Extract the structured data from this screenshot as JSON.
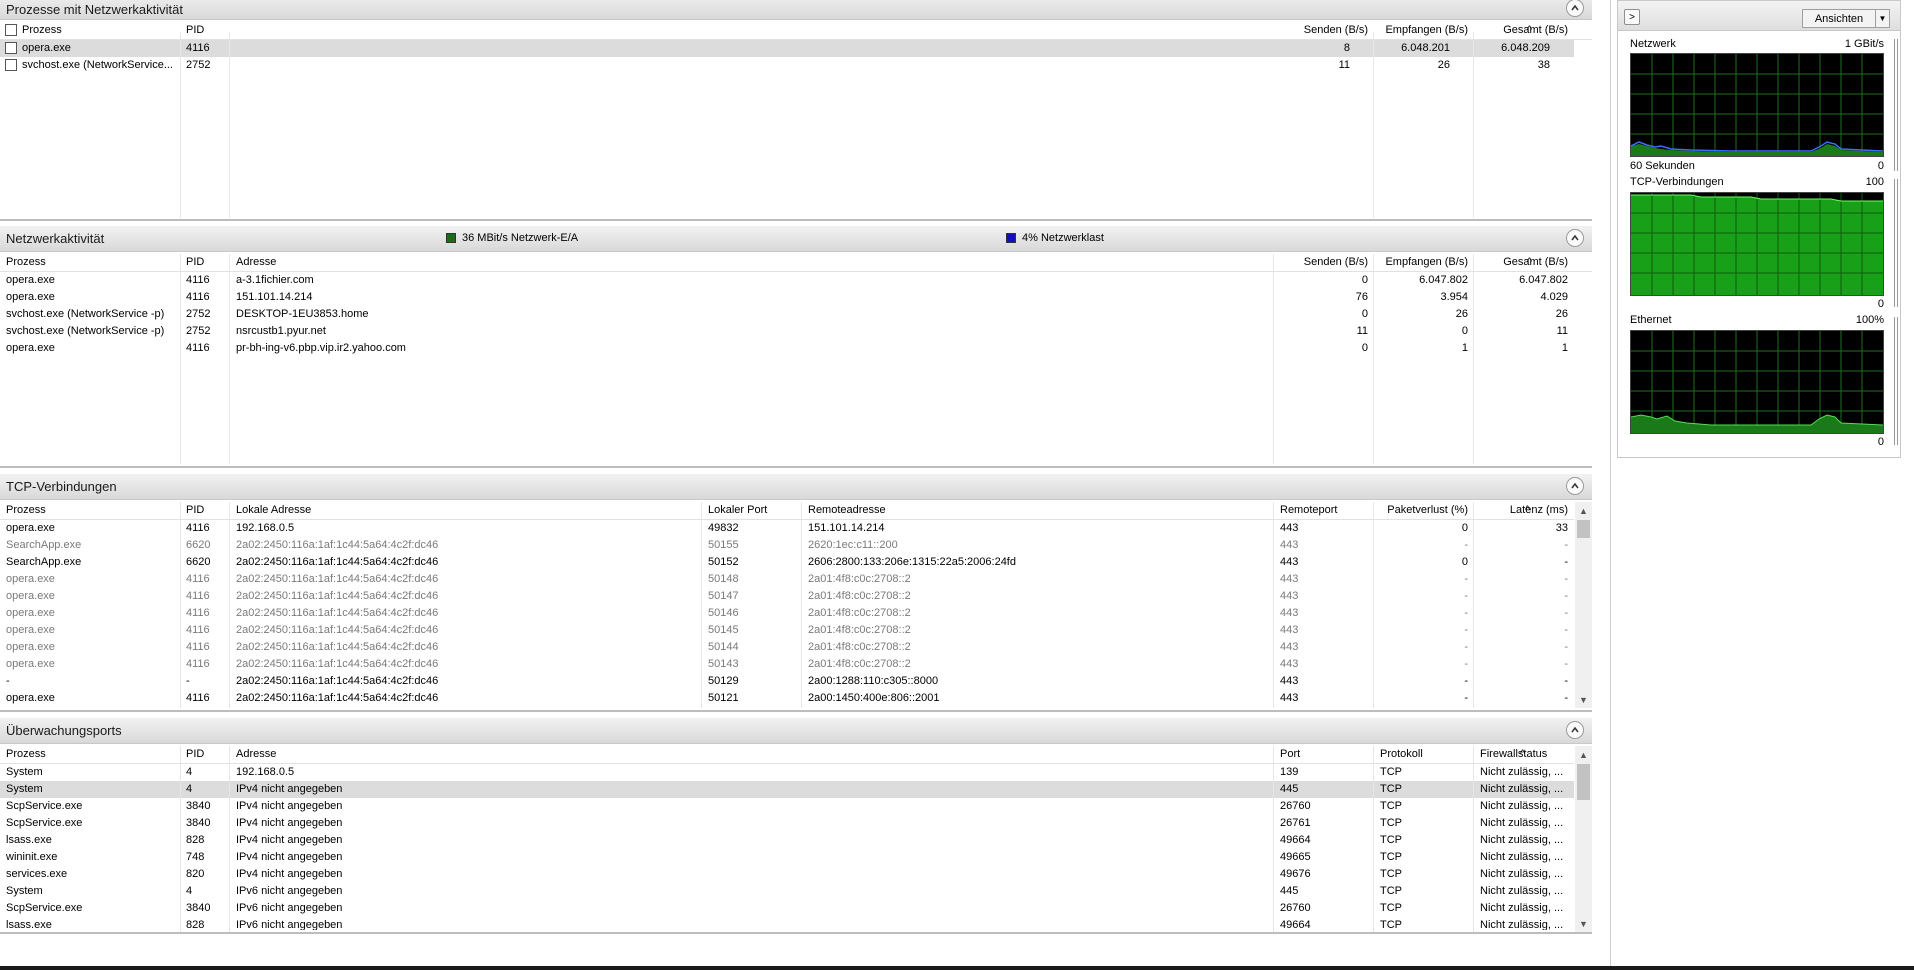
{
  "proc_section": {
    "title": "Prozesse mit Netzwerkaktivität",
    "columns": [
      "Prozess",
      "PID",
      "Senden (B/s)",
      "Empfangen (B/s)",
      "Gesamt (B/s)"
    ],
    "rows": [
      {
        "name": "opera.exe",
        "pid": "4116",
        "send": "8",
        "recv": "6.048.201",
        "total": "6.048.209"
      },
      {
        "name": "svchost.exe (NetworkService...",
        "pid": "2752",
        "send": "11",
        "recv": "26",
        "total": "38"
      }
    ]
  },
  "net_section": {
    "title": "Netzwerkaktivität",
    "legend_io": "36 MBit/s Netzwerk-E/A",
    "legend_io_color": "#1a6e1a",
    "legend_load": "4% Netzwerklast",
    "legend_load_color": "#1010c0",
    "columns": [
      "Prozess",
      "PID",
      "Adresse",
      "Senden (B/s)",
      "Empfangen (B/s)",
      "Gesamt (B/s)"
    ],
    "rows": [
      {
        "name": "opera.exe",
        "pid": "4116",
        "addr": "a-3.1fichier.com",
        "send": "0",
        "recv": "6.047.802",
        "total": "6.047.802"
      },
      {
        "name": "opera.exe",
        "pid": "4116",
        "addr": "151.101.14.214",
        "send": "76",
        "recv": "3.954",
        "total": "4.029"
      },
      {
        "name": "svchost.exe (NetworkService -p)",
        "pid": "2752",
        "addr": "DESKTOP-1EU3853.home",
        "send": "0",
        "recv": "26",
        "total": "26"
      },
      {
        "name": "svchost.exe (NetworkService -p)",
        "pid": "2752",
        "addr": "nsrcustb1.pyur.net",
        "send": "11",
        "recv": "0",
        "total": "11"
      },
      {
        "name": "opera.exe",
        "pid": "4116",
        "addr": "pr-bh-ing-v6.pbp.vip.ir2.yahoo.com",
        "send": "0",
        "recv": "1",
        "total": "1"
      }
    ]
  },
  "tcp_section": {
    "title": "TCP-Verbindungen",
    "columns": [
      "Prozess",
      "PID",
      "Lokale Adresse",
      "Lokaler Port",
      "Remoteadresse",
      "Remoteport",
      "Paketverlust (%)",
      "Latenz (ms)"
    ],
    "rows": [
      {
        "name": "opera.exe",
        "pid": "4116",
        "laddr": "192.168.0.5",
        "lport": "49832",
        "raddr": "151.101.14.214",
        "rport": "443",
        "loss": "0",
        "lat": "33",
        "dim": false
      },
      {
        "name": "SearchApp.exe",
        "pid": "6620",
        "laddr": "2a02:2450:116a:1af:1c44:5a64:4c2f:dc46",
        "lport": "50155",
        "raddr": "2620:1ec:c11::200",
        "rport": "443",
        "loss": "-",
        "lat": "-",
        "dim": true
      },
      {
        "name": "SearchApp.exe",
        "pid": "6620",
        "laddr": "2a02:2450:116a:1af:1c44:5a64:4c2f:dc46",
        "lport": "50152",
        "raddr": "2606:2800:133:206e:1315:22a5:2006:24fd",
        "rport": "443",
        "loss": "0",
        "lat": "-",
        "dim": false
      },
      {
        "name": "opera.exe",
        "pid": "4116",
        "laddr": "2a02:2450:116a:1af:1c44:5a64:4c2f:dc46",
        "lport": "50148",
        "raddr": "2a01:4f8:c0c:2708::2",
        "rport": "443",
        "loss": "-",
        "lat": "-",
        "dim": true
      },
      {
        "name": "opera.exe",
        "pid": "4116",
        "laddr": "2a02:2450:116a:1af:1c44:5a64:4c2f:dc46",
        "lport": "50147",
        "raddr": "2a01:4f8:c0c:2708::2",
        "rport": "443",
        "loss": "-",
        "lat": "-",
        "dim": true
      },
      {
        "name": "opera.exe",
        "pid": "4116",
        "laddr": "2a02:2450:116a:1af:1c44:5a64:4c2f:dc46",
        "lport": "50146",
        "raddr": "2a01:4f8:c0c:2708::2",
        "rport": "443",
        "loss": "-",
        "lat": "-",
        "dim": true
      },
      {
        "name": "opera.exe",
        "pid": "4116",
        "laddr": "2a02:2450:116a:1af:1c44:5a64:4c2f:dc46",
        "lport": "50145",
        "raddr": "2a01:4f8:c0c:2708::2",
        "rport": "443",
        "loss": "-",
        "lat": "-",
        "dim": true
      },
      {
        "name": "opera.exe",
        "pid": "4116",
        "laddr": "2a02:2450:116a:1af:1c44:5a64:4c2f:dc46",
        "lport": "50144",
        "raddr": "2a01:4f8:c0c:2708::2",
        "rport": "443",
        "loss": "-",
        "lat": "-",
        "dim": true
      },
      {
        "name": "opera.exe",
        "pid": "4116",
        "laddr": "2a02:2450:116a:1af:1c44:5a64:4c2f:dc46",
        "lport": "50143",
        "raddr": "2a01:4f8:c0c:2708::2",
        "rport": "443",
        "loss": "-",
        "lat": "-",
        "dim": true
      },
      {
        "name": "-",
        "pid": "-",
        "laddr": "2a02:2450:116a:1af:1c44:5a64:4c2f:dc46",
        "lport": "50129",
        "raddr": "2a00:1288:110:c305::8000",
        "rport": "443",
        "loss": "-",
        "lat": "-",
        "dim": false
      },
      {
        "name": "opera.exe",
        "pid": "4116",
        "laddr": "2a02:2450:116a:1af:1c44:5a64:4c2f:dc46",
        "lport": "50121",
        "raddr": "2a00:1450:400e:806::2001",
        "rport": "443",
        "loss": "-",
        "lat": "-",
        "dim": false
      }
    ]
  },
  "ports_section": {
    "title": "Überwachungsports",
    "columns": [
      "Prozess",
      "PID",
      "Adresse",
      "Port",
      "Protokoll",
      "Firewallstatus"
    ],
    "rows": [
      {
        "name": "System",
        "pid": "4",
        "addr": "192.168.0.5",
        "port": "139",
        "proto": "TCP",
        "fw": "Nicht zulässig, ..."
      },
      {
        "name": "System",
        "pid": "4",
        "addr": "IPv4 nicht angegeben",
        "port": "445",
        "proto": "TCP",
        "fw": "Nicht zulässig, ..."
      },
      {
        "name": "ScpService.exe",
        "pid": "3840",
        "addr": "IPv4 nicht angegeben",
        "port": "26760",
        "proto": "TCP",
        "fw": "Nicht zulässig, ..."
      },
      {
        "name": "ScpService.exe",
        "pid": "3840",
        "addr": "IPv4 nicht angegeben",
        "port": "26761",
        "proto": "TCP",
        "fw": "Nicht zulässig, ..."
      },
      {
        "name": "lsass.exe",
        "pid": "828",
        "addr": "IPv4 nicht angegeben",
        "port": "49664",
        "proto": "TCP",
        "fw": "Nicht zulässig, ..."
      },
      {
        "name": "wininit.exe",
        "pid": "748",
        "addr": "IPv4 nicht angegeben",
        "port": "49665",
        "proto": "TCP",
        "fw": "Nicht zulässig, ..."
      },
      {
        "name": "services.exe",
        "pid": "820",
        "addr": "IPv4 nicht angegeben",
        "port": "49676",
        "proto": "TCP",
        "fw": "Nicht zulässig, ..."
      },
      {
        "name": "System",
        "pid": "4",
        "addr": "IPv6 nicht angegeben",
        "port": "445",
        "proto": "TCP",
        "fw": "Nicht zulässig, ..."
      },
      {
        "name": "ScpService.exe",
        "pid": "3840",
        "addr": "IPv6 nicht angegeben",
        "port": "26760",
        "proto": "TCP",
        "fw": "Nicht zulässig, ..."
      },
      {
        "name": "lsass.exe",
        "pid": "828",
        "addr": "IPv6 nicht angegeben",
        "port": "49664",
        "proto": "TCP",
        "fw": "Nicht zulässig, ..."
      }
    ]
  },
  "side": {
    "views_label": "Ansichten",
    "graphs": [
      {
        "title": "Netzwerk",
        "max": "1 GBit/s",
        "time_label": "60 Sekunden",
        "min": "0"
      },
      {
        "title": "TCP-Verbindungen",
        "max": "100",
        "time_label": "",
        "min": "0"
      },
      {
        "title": "Ethernet",
        "max": "100%",
        "time_label": "",
        "min": "0"
      }
    ]
  }
}
